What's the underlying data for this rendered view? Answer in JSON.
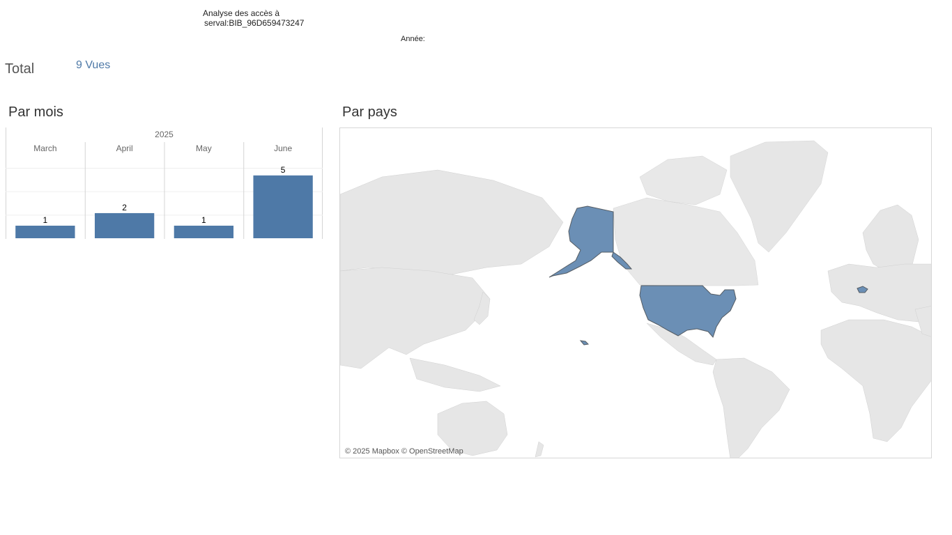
{
  "header": {
    "title_line1": "Analyse des accès à",
    "title_line2": "serval:BIB_96D659473247",
    "year_label": "Année:"
  },
  "summary": {
    "total_label": "Total",
    "views_value": "9 Vues"
  },
  "sections": {
    "by_month_title": "Par mois",
    "by_country_title": "Par pays"
  },
  "chart_data": {
    "type": "bar",
    "title": "",
    "group_label": "2025",
    "categories": [
      "March",
      "April",
      "May",
      "June"
    ],
    "values": [
      1,
      2,
      1,
      5
    ],
    "data_labels": [
      "1",
      "2",
      "1",
      "5"
    ],
    "ylim": [
      0,
      5.6
    ],
    "grid": true,
    "bar_color": "#4e79a7"
  },
  "map": {
    "highlighted_countries": [
      "United States",
      "Switzerland"
    ],
    "highlight_color": "#6b8fb5",
    "land_color": "#e6e6e6",
    "water_color": "#ffffff",
    "attribution": "© 2025 Mapbox © OpenStreetMap"
  }
}
